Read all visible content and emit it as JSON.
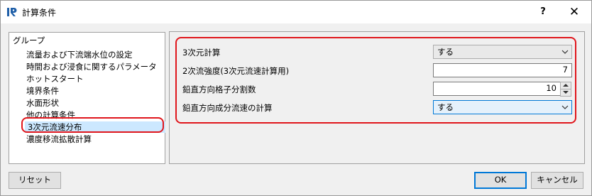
{
  "window": {
    "title": "計算条件",
    "help_label": "?",
    "close_label": "✕"
  },
  "group_panel": {
    "header": "グループ",
    "items": [
      {
        "label": "流量および下流端水位の設定"
      },
      {
        "label": "時間および浸食に関するパラメータ"
      },
      {
        "label": "ホットスタート"
      },
      {
        "label": "境界条件"
      },
      {
        "label": "水面形状"
      },
      {
        "label": "他の計算条件"
      },
      {
        "label": "3次元流速分布"
      },
      {
        "label": "濃度移流拡散計算"
      }
    ],
    "selected_index": 6
  },
  "properties": {
    "rows": [
      {
        "label": "3次元計算",
        "type": "combo",
        "value": "する"
      },
      {
        "label": "2次流強度(3次元流速計算用)",
        "type": "number",
        "value": "7"
      },
      {
        "label": "鉛直方向格子分割数",
        "type": "spin",
        "value": "10"
      },
      {
        "label": "鉛直方向成分流速の計算",
        "type": "combo",
        "value": "する"
      }
    ]
  },
  "footer": {
    "reset_label": "リセット",
    "ok_label": "OK",
    "cancel_label": "キャンセル"
  },
  "colors": {
    "highlight": "#e0161c",
    "selection": "#cce8ff",
    "focus_accent": "#0078d7"
  },
  "icons": {
    "app": "iric-logo-icon",
    "dropdown": "chevron-down-icon",
    "spin_up": "triangle-up-icon",
    "spin_down": "triangle-down-icon"
  }
}
